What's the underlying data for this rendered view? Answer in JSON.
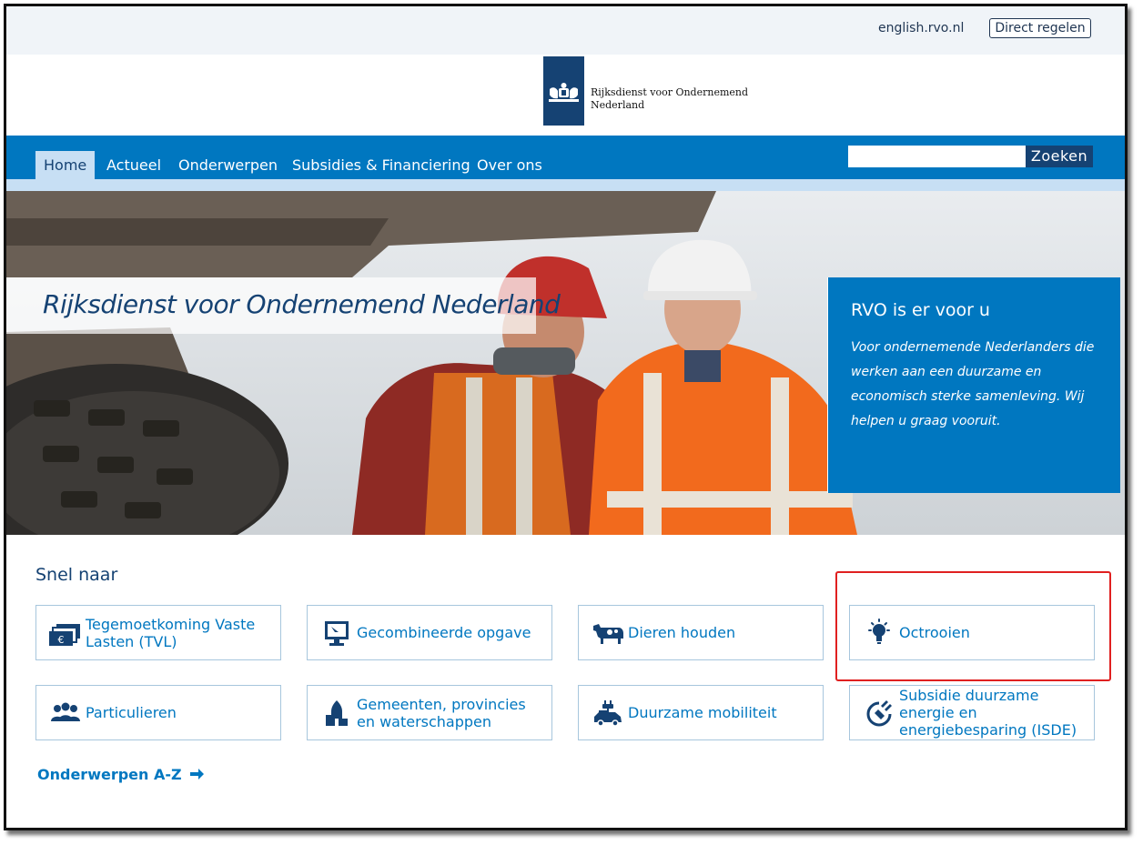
{
  "util": {
    "english_link": "english.rvo.nl",
    "direct_button": "Direct regelen"
  },
  "logo": {
    "line1": "Rijksdienst voor Ondernemend",
    "line2": "Nederland"
  },
  "nav": {
    "items": [
      {
        "label": "Home",
        "active": true
      },
      {
        "label": "Actueel"
      },
      {
        "label": "Onderwerpen"
      },
      {
        "label": "Subsidies & Financiering"
      },
      {
        "label": "Over ons"
      }
    ],
    "search_button": "Zoeken"
  },
  "hero": {
    "title": "Rijksdienst voor Ondernemend Nederland",
    "box_title": "RVO is er voor u",
    "box_text": "Voor ondernemende Nederlanders die werken aan een duurzame en economisch sterke samenleving. Wij helpen u graag vooruit."
  },
  "snel": {
    "title": "Snel naar",
    "tiles": [
      {
        "label": "Tegemoetkoming Vaste Lasten (TVL)",
        "icon": "banknote-icon"
      },
      {
        "label": "Gecombineerde opgave",
        "icon": "monitor-icon"
      },
      {
        "label": "Dieren houden",
        "icon": "cow-icon"
      },
      {
        "label": "Octrooien",
        "icon": "lightbulb-icon"
      },
      {
        "label": "Particulieren",
        "icon": "people-icon"
      },
      {
        "label": "Gemeenten, provincies en waterschappen",
        "icon": "municipality-icon"
      },
      {
        "label": "Duurzame mobiliteit",
        "icon": "electric-car-icon"
      },
      {
        "label": "Subsidie duurzame energie en energiebesparing (ISDE)",
        "icon": "energy-plug-icon"
      }
    ],
    "az_link": "Onderwerpen A-Z"
  },
  "colors": {
    "brand_blue": "#0077c0",
    "dark_blue": "#154273",
    "light_blue": "#c7dff4",
    "highlight_red": "#e02020"
  }
}
